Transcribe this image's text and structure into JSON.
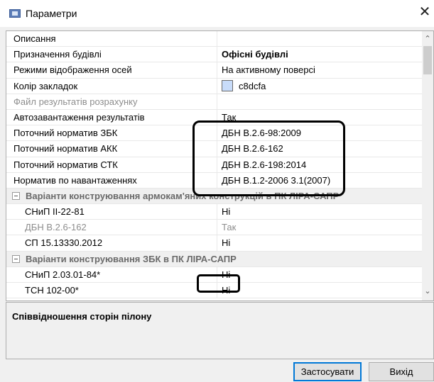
{
  "window": {
    "title": "Параметри",
    "app_icon": "window-icon",
    "close_glyph": "✕"
  },
  "rows": [
    {
      "name": "Описання",
      "value": "",
      "type": "normal"
    },
    {
      "name": "Призначення будівлі",
      "value": "Офісні будівлі",
      "type": "normal",
      "bold": true
    },
    {
      "name": "Режими відображення осей",
      "value": "На активному поверсі",
      "type": "normal"
    },
    {
      "name": "Колір закладок",
      "value": "c8dcfa",
      "type": "color",
      "color": "#c8dcfa"
    },
    {
      "name": "Файл результатів розрахунку",
      "value": "",
      "type": "disabled"
    },
    {
      "name": "Автозавантаження результатів",
      "value": "Так",
      "type": "normal"
    },
    {
      "name": "Поточний норматив ЗБК",
      "value": "ДБН В.2.6-98:2009",
      "type": "normal"
    },
    {
      "name": "Поточний норматив АКК",
      "value": "ДБН В.2.6-162",
      "type": "normal"
    },
    {
      "name": "Поточний норматив СТК",
      "value": "ДБН В.2.6-198:2014",
      "type": "normal"
    },
    {
      "name": "Норматив по навантаженнях",
      "value": "ДБН В.1.2-2006 3.1(2007)",
      "type": "normal"
    },
    {
      "name": "Варіанти конструювання армокам'яних конструкцій в ПК ЛІРА-САПР",
      "value": "",
      "type": "group"
    },
    {
      "name": "СНиП II-22-81",
      "value": "Ні",
      "type": "sub"
    },
    {
      "name": "ДБН В.2.6-162",
      "value": "Так",
      "type": "sub-disabled"
    },
    {
      "name": "СП 15.13330.2012",
      "value": "Ні",
      "type": "sub"
    },
    {
      "name": "Варіанти конструювання ЗБК в ПК ЛІРА-САПР",
      "value": "",
      "type": "group"
    },
    {
      "name": "СНиП 2.03.01-84*",
      "value": "Ні",
      "type": "sub"
    },
    {
      "name": "ТСН 102-00*",
      "value": "Ні",
      "type": "sub"
    }
  ],
  "scroll": {
    "up_glyph": "⌃",
    "down_glyph": "⌄"
  },
  "description": "Співвідношення сторін пілону",
  "buttons": {
    "apply": "Застосувати",
    "exit": "Вихід"
  }
}
